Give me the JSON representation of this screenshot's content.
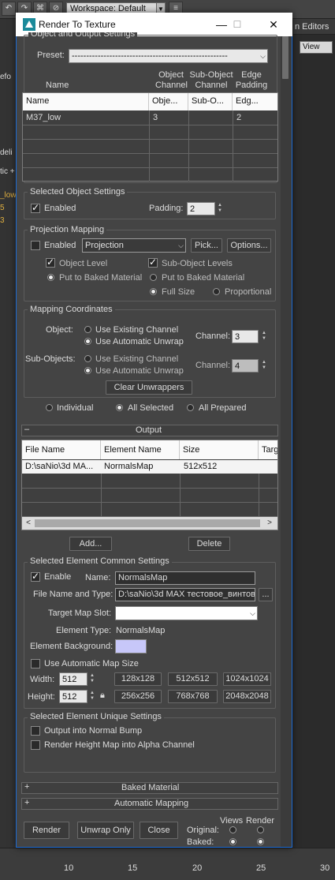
{
  "background_app": {
    "workspace_label": "Workspace: Default",
    "right_tab": "n Editors",
    "view_dropdown": "View",
    "left_fragments": [
      "efo",
      "deli",
      "tic +",
      "_low",
      "5",
      "3"
    ],
    "ruler_numbers": [
      "10",
      "15",
      "20",
      "25",
      "30"
    ]
  },
  "dialog": {
    "title": "Render To Texture",
    "window_controls": [
      "—",
      "☐",
      "✕"
    ],
    "object_output": {
      "group_label": "Object and Output Settings",
      "preset_label": "Preset:",
      "preset_value": "------------------------------------------------------",
      "column_headers_top": {
        "name": "Name",
        "object_channel": [
          "Object",
          "Channel"
        ],
        "sub_object_channel": [
          "Sub-Object",
          "Channel"
        ],
        "edge_padding": [
          "Edge",
          "Padding"
        ]
      },
      "table": {
        "headers": [
          "Name",
          "Obje...",
          "Sub-O...",
          "Edg..."
        ],
        "rows": [
          [
            "M37_low",
            "3",
            "",
            "2"
          ]
        ]
      }
    },
    "selected_object": {
      "group_label": "Selected Object Settings",
      "enabled_label": "Enabled",
      "enabled_checked": true,
      "padding_label": "Padding:",
      "padding_value": "2"
    },
    "projection_mapping": {
      "group_label": "Projection Mapping",
      "enabled_label": "Enabled",
      "enabled_checked": false,
      "projection_value": "Projection",
      "pick_button": "Pick...",
      "options_button": "Options...",
      "object_level_label": "Object Level",
      "sub_object_levels_label": "Sub-Object Levels",
      "put_baked_1": "Put to Baked Material",
      "put_baked_2": "Put to Baked Material",
      "full_size_label": "Full Size",
      "proportional_label": "Proportional"
    },
    "mapping_coordinates": {
      "group_label": "Mapping Coordinates",
      "object_label": "Object:",
      "sub_objects_label": "Sub-Objects:",
      "use_existing": "Use Existing Channel",
      "use_auto": "Use Automatic Unwrap",
      "use_existing_2": "Use Existing Channel",
      "use_auto_2": "Use Automatic Unwrap",
      "channel_label": "Channel:",
      "channel_value_1": "3",
      "channel_label_2": "Channel:",
      "channel_value_2": "4",
      "clear_button": "Clear Unwrappers"
    },
    "selection_mode": {
      "individual": "Individual",
      "all_selected": "All Selected",
      "all_prepared": "All Prepared",
      "selected": "all_selected"
    },
    "output": {
      "rollout_label": "Output",
      "rollout_sign": "–",
      "table": {
        "headers": [
          "File Name",
          "Element Name",
          "Size",
          "Targ"
        ],
        "rows": [
          [
            "D:\\saNio\\3d MA...",
            "NormalsMap",
            "512x512",
            ""
          ]
        ]
      },
      "add_button": "Add...",
      "delete_button": "Delete"
    },
    "element_common": {
      "group_label": "Selected Element Common Settings",
      "enable_label": "Enable",
      "enable_checked": true,
      "name_label": "Name:",
      "name_value": "NormalsMap",
      "file_label": "File Name and Type:",
      "file_value": "D:\\saNio\\3d MAX тестовое_винтов",
      "file_browse": "...",
      "target_slot_label": "Target Map Slot:",
      "target_slot_value": "",
      "element_type_label": "Element Type:",
      "element_type_value": "NormalsMap",
      "element_bg_label": "Element Background:",
      "element_bg_color": "#c7c7f9",
      "use_auto_size_label": "Use Automatic Map Size",
      "width_label": "Width:",
      "width_value": "512",
      "height_label": "Height:",
      "height_value": "512",
      "size_buttons": [
        "128x128",
        "512x512",
        "1024x1024",
        "256x256",
        "768x768",
        "2048x2048"
      ]
    },
    "element_unique": {
      "group_label": "Selected Element Unique Settings",
      "output_normal_bump": "Output into Normal Bump",
      "render_height_map": "Render Height Map into Alpha Channel"
    },
    "rollouts": {
      "baked_material": "Baked Material",
      "automatic_mapping": "Automatic Mapping",
      "sign": "+"
    },
    "bottom": {
      "render_button": "Render",
      "unwrap_only_button": "Unwrap Only",
      "close_button": "Close",
      "views_label": "Views",
      "render_col_label": "Render",
      "original_label": "Original:",
      "baked_label": "Baked:"
    }
  }
}
